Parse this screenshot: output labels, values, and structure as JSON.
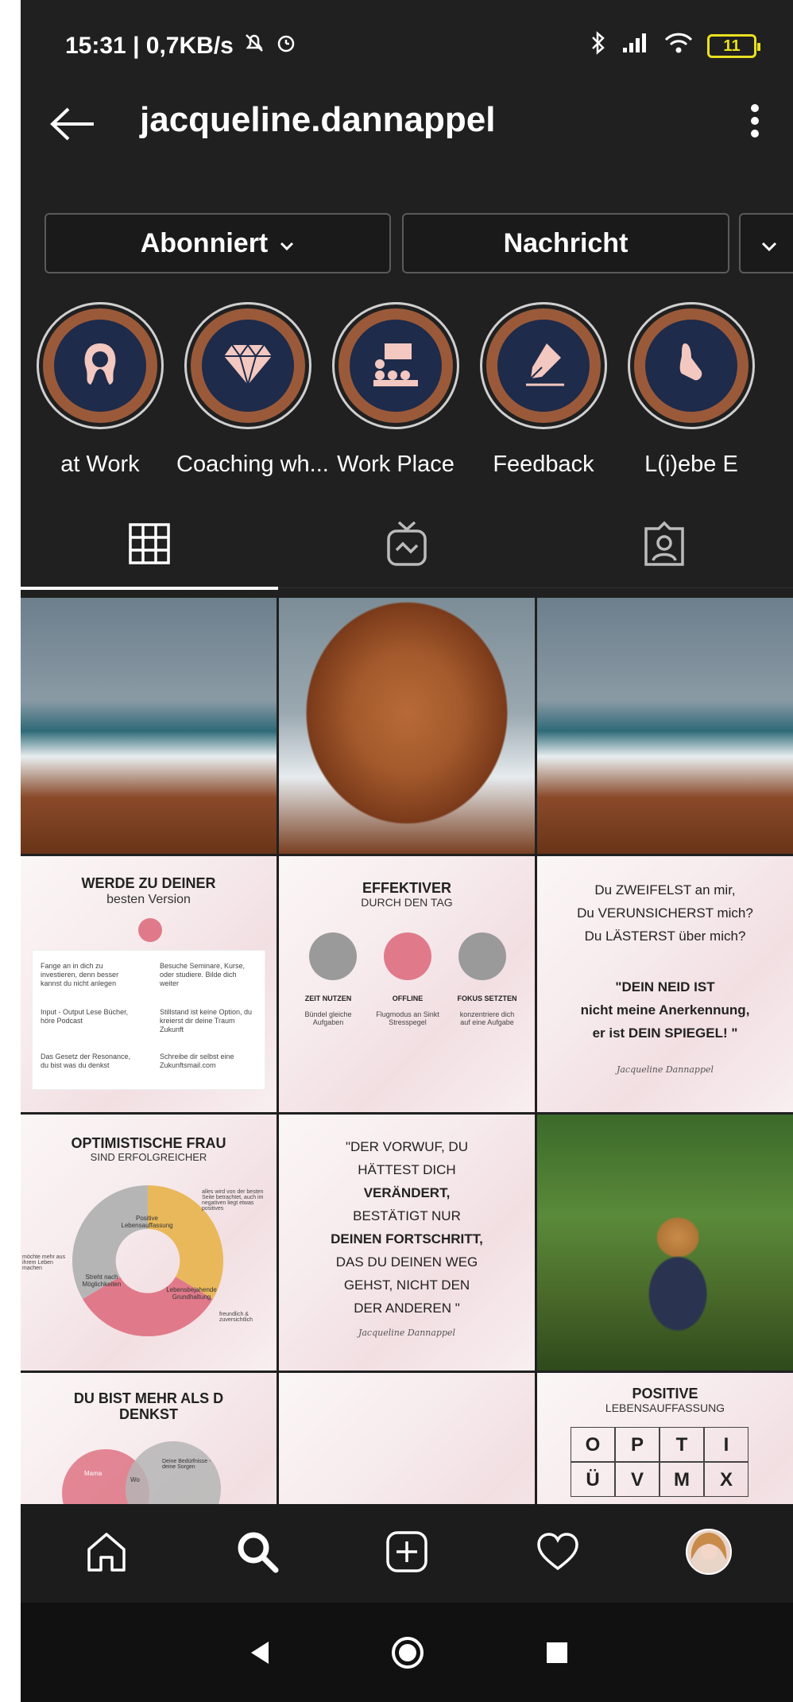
{
  "status_bar": {
    "time_speed": "15:31 | 0,7KB/s",
    "battery": "11"
  },
  "header": {
    "username": "jacqueline.dannappel"
  },
  "actions": {
    "follow_label": "Abonniert",
    "message_label": "Nachricht"
  },
  "highlights": [
    {
      "label": "at Work",
      "icon": "hair-icon"
    },
    {
      "label": "Coaching wh...",
      "icon": "diamond-icon"
    },
    {
      "label": "Work Place",
      "icon": "audience-icon"
    },
    {
      "label": "Feedback",
      "icon": "pen-icon"
    },
    {
      "label": "L(i)ebe E",
      "icon": "hand-icon"
    }
  ],
  "tabs": [
    "grid-icon",
    "igtv-icon",
    "tagged-icon"
  ],
  "posts": {
    "p4": {
      "title": "WERDE ZU DEINER",
      "sub": "besten Version",
      "items": [
        "Fange an in dich zu investieren, denn besser kannst du nicht anlegen",
        "Besuche Seminare, Kurse, oder studiere. Bilde dich weiter",
        "Input - Output Lese Bücher, höre Podcast",
        "Stillstand ist keine Option, du kreierst dir deine Traum Zukunft",
        "Das Gesetz der Resonance, du bist was du denkst",
        "Schreibe dir selbst eine Zukunftsmail.com"
      ]
    },
    "p5": {
      "title": "EFFEKTIVER",
      "sub": "DURCH DEN TAG",
      "cols": [
        {
          "head": "ZEIT NUTZEN",
          "body": "Bündel gleiche Aufgaben"
        },
        {
          "head": "OFFLINE",
          "body": "Flugmodus an Sinkt Stresspegel"
        },
        {
          "head": "FOKUS SETZTEN",
          "body": "konzentriere dich auf eine Aufgabe"
        }
      ]
    },
    "p6": {
      "lines": [
        "Du ZWEIFELST an mir,",
        "Du VERUNSICHERST mich?",
        "Du LÄSTERST über mich?"
      ],
      "bold_lines": [
        "\"DEIN NEID IST",
        "nicht meine Anerkennung,",
        "er ist DEIN SPIEGEL! \""
      ],
      "signature": "Jacqueline Dannappel"
    },
    "p7": {
      "title": "OPTIMISTISCHE FRAU",
      "sub": "SIND ERFOLGREICHER",
      "segments": [
        {
          "label": "Positive Lebensauffassung",
          "color": "#b5b5b5"
        },
        {
          "label": "Lebensbejahende Grundhaltung",
          "color": "#e9b85a"
        },
        {
          "label": "Streht nach Möglichkeiten",
          "color": "#e07a8a"
        }
      ],
      "notes": [
        "alles wird von der besten Seite betrachtet, auch im negativen liegt etwas positives",
        "freundlich & zuversichtlich",
        "möchte mehr aus ihrem Leben machen"
      ]
    },
    "p8": {
      "lines": [
        "\"DER VORWUF, DU",
        "HÄTTEST DICH",
        "VERÄNDERT,",
        "BESTÄTIGT NUR",
        "DEINEN FORTSCHRITT,",
        "DAS DU DEINEN WEG",
        "GEHST, NICHT DEN",
        "DER ANDEREN \""
      ],
      "signature": "Jacqueline Dannappel"
    },
    "p10": {
      "title": "DU BIST MEHR ALS D",
      "sub": "DENKST",
      "venn_left": "Mama",
      "venn_mid": "Wo",
      "venn_right": "Deine Bedürfnisse - deine Sorgen"
    },
    "p12": {
      "title": "POSITIVE",
      "sub": "LEBENSAUFFASSUNG",
      "row1": [
        "O",
        "P",
        "T",
        "I"
      ],
      "row2": [
        "Ü",
        "V",
        "M",
        "X"
      ]
    }
  },
  "colors": {
    "background": "#202020",
    "highlight_ring": "#9a5a3a",
    "highlight_core": "#1e2b4a",
    "accent_pink": "#e07a8a"
  }
}
